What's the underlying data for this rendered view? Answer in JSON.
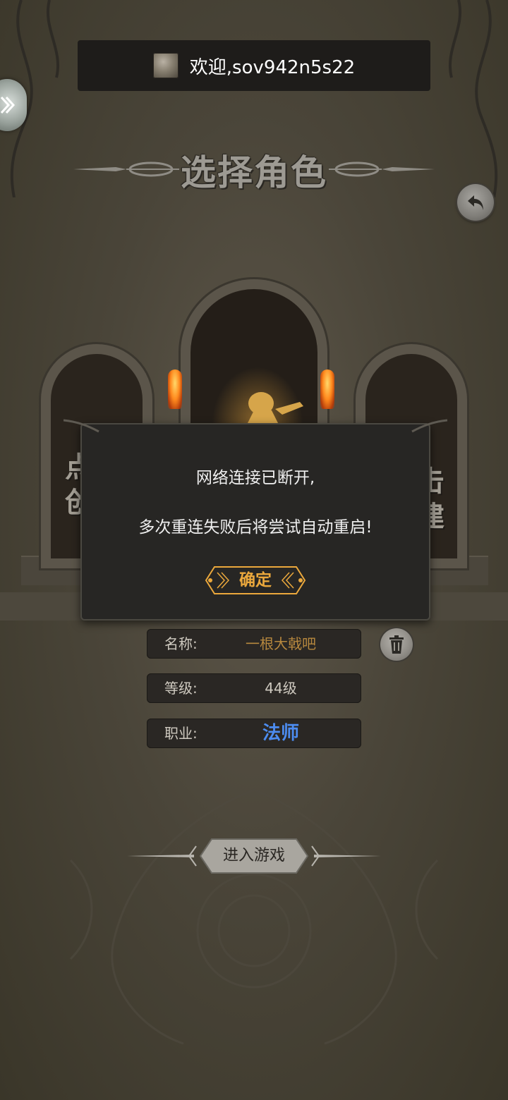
{
  "header": {
    "welcome_text": "欢迎,sov942n5s22"
  },
  "title": "选择角色",
  "scene": {
    "side_left_line1": "点",
    "side_left_line2": "创",
    "side_right_line1": "击",
    "side_right_line2": "建"
  },
  "dialog": {
    "line1": "网络连接已断开,",
    "line2": "多次重连失败后将尝试自动重启!",
    "confirm_label": "确定"
  },
  "character": {
    "name_label": "名称:",
    "name_value": "一根大戟吧",
    "level_label": "等级:",
    "level_value": "44级",
    "class_label": "职业:",
    "class_value": "法师"
  },
  "enter_button_label": "进入游戏",
  "colors": {
    "accent_gold": "#eba83c",
    "name_color": "#b7883e",
    "class_color": "#4c8cf0",
    "level_color": "#cfcac0"
  }
}
